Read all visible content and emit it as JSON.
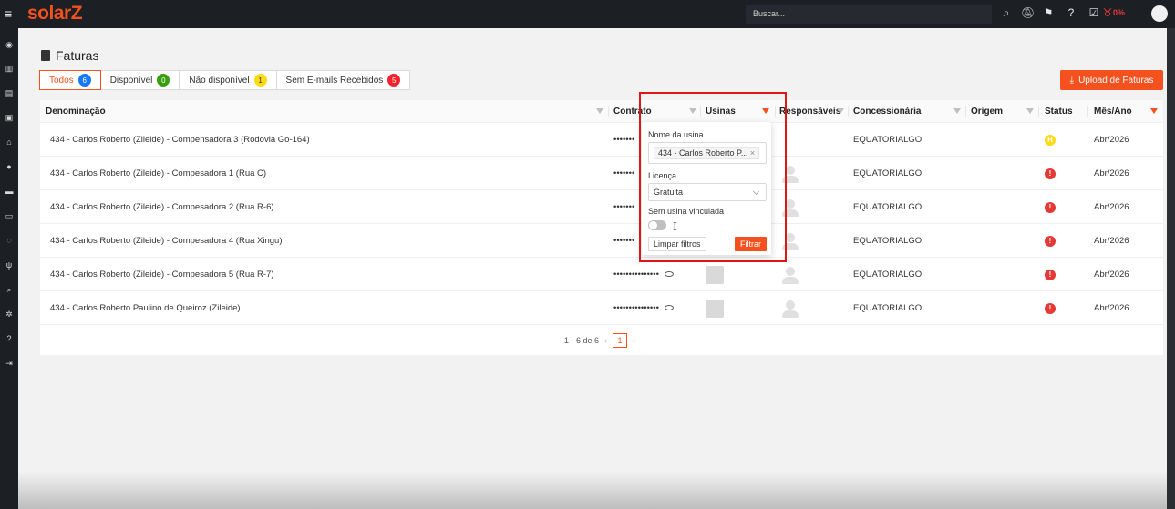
{
  "app": {
    "logo_part1": "solar",
    "logo_part2": "Z"
  },
  "header": {
    "search_placeholder": "Buscar...",
    "progress": "0%",
    "icons": [
      "search-icon",
      "bell-off-icon",
      "flag-icon",
      "help-icon",
      "checklist-icon",
      "trophy-icon"
    ]
  },
  "sidebar": {
    "icons": [
      "dashboard-icon",
      "book-icon",
      "invoice-icon",
      "money-icon",
      "home-icon",
      "user-icon",
      "card-icon",
      "credit-card-icon",
      "whatsapp-icon",
      "plug-icon",
      "search-icon",
      "settings-icon",
      "help-icon",
      "logout-icon"
    ]
  },
  "page": {
    "title": "Faturas"
  },
  "tabs": [
    {
      "label": "Todos",
      "count": "6",
      "color": "#1677ff"
    },
    {
      "label": "Disponível",
      "count": "0",
      "color": "#389e0d"
    },
    {
      "label": "Não disponível",
      "count": "1",
      "color": "#fadb14"
    },
    {
      "label": "Sem E-mails Recebidos",
      "count": "5",
      "color": "#f5222d"
    }
  ],
  "upload_button": "Upload de Faturas",
  "columns": {
    "denominacao": "Denominação",
    "contrato": "Contrato",
    "usinas": "Usinas",
    "responsaveis": "Responsáveis",
    "concessionaria": "Concessionária",
    "origem": "Origem",
    "status": "Status",
    "mes_ano": "Mês/Ano"
  },
  "rows": [
    {
      "name": "434 - Carlos Roberto (Zileide) - Compensadora 3 (Rodovia Go-164)",
      "contract": "•••••••",
      "utility": "EQUATORIALGO",
      "status": "H",
      "status_color": "#fadb14",
      "month": "Abr/2026"
    },
    {
      "name": "434 - Carlos Roberto (Zileide) - Compesadora 1 (Rua C)",
      "contract": "•••••••",
      "utility": "EQUATORIALGO",
      "status": "!",
      "status_color": "#e53935",
      "month": "Abr/2026"
    },
    {
      "name": "434 - Carlos Roberto (Zileide) - Compesadora 2 (Rua R-6)",
      "contract": "•••••••",
      "utility": "EQUATORIALGO",
      "status": "!",
      "status_color": "#e53935",
      "month": "Abr/2026"
    },
    {
      "name": "434 - Carlos Roberto (Zileide) - Compesadora 4 (Rua Xingu)",
      "contract": "•••••••",
      "utility": "EQUATORIALGO",
      "status": "!",
      "status_color": "#e53935",
      "month": "Abr/2026"
    },
    {
      "name": "434 - Carlos Roberto (Zileide) - Compesadora 5 (Rua R-7)",
      "contract": "•••••••••••••••",
      "utility": "EQUATORIALGO",
      "status": "!",
      "status_color": "#e53935",
      "month": "Abr/2026"
    },
    {
      "name": "434 - Carlos Roberto Paulino de Queiroz (Zileide)",
      "contract": "•••••••••••••••",
      "utility": "EQUATORIALGO",
      "status": "!",
      "status_color": "#e53935",
      "month": "Abr/2026"
    }
  ],
  "pagination": {
    "range": "1 - 6 de 6",
    "current_page": "1"
  },
  "filter_popup": {
    "usina_label": "Nome da usina",
    "usina_value": "434 - Carlos Roberto P...",
    "license_label": "Licença",
    "license_value": "Gratuita",
    "toggle_label": "Sem usina vinculada",
    "clear_button": "Limpar filtros",
    "apply_button": "Filtrar"
  }
}
